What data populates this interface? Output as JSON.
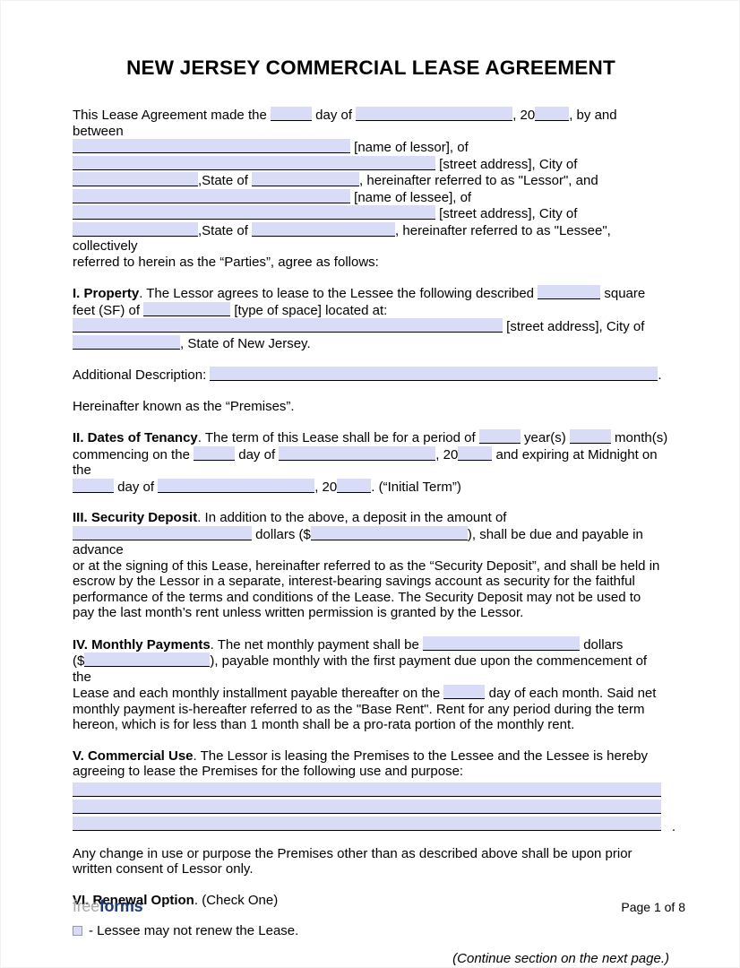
{
  "document": {
    "title": "NEW JERSEY COMMERCIAL LEASE AGREEMENT"
  },
  "intro": {
    "line1_a": "This Lease Agreement made the",
    "line1_b": "day of",
    "line1_c": ", 20",
    "line1_d": ", by and between",
    "line2": "[name of lessor], of",
    "line3": "[street address], City of",
    "line4_a": ",State of",
    "line4_b": ", hereinafter referred to as \"Lessor\", and",
    "line5": "[name of lessee], of",
    "line6": "[street address], City of",
    "line7_a": ",State of",
    "line7_b": ", hereinafter referred to as \"Lessee\", collectively",
    "line8": "referred to herein as the “Parties”, agree as follows:"
  },
  "sections": {
    "property": {
      "heading": "I. Property",
      "line1_a": ". The Lessor agrees to lease to the Lessee the following described",
      "line1_b": "square",
      "line2_a": "feet (SF) of",
      "line2_b": "[type of space] located at:",
      "line3": "[street address], City of",
      "line4": ", State of New Jersey.",
      "additional_label": "Additional Description:",
      "additional_period": ".",
      "hereinafter": "Hereinafter known as the “Premises”."
    },
    "dates": {
      "heading": "II. Dates of Tenancy",
      "line1_a": ". The term of this Lease shall be for a period of",
      "line1_b": "year(s)",
      "line1_c": "month(s)",
      "line2_a": "commencing on the",
      "line2_b": "day of",
      "line2_c": ", 20",
      "line2_d": "and expiring at Midnight on the",
      "line3_a": "day of",
      "line3_b": ", 20",
      "line3_c": ". (“Initial Term”)"
    },
    "security": {
      "heading": "III. Security Deposit",
      "line1": ". In addition to the above, a deposit in the amount of",
      "line2_a": "dollars ($",
      "line2_b": "), shall be due and payable in advance",
      "line3": "or at the signing of this Lease, hereinafter referred to as the “Security Deposit”, and shall be held in",
      "line4": "escrow by the Lessor in a separate, interest-bearing savings account as security for the faithful",
      "line5": "performance of the terms and conditions of the Lease. The Security Deposit may not be used to",
      "line6": "pay the last month’s rent unless written permission is granted by the Lessor."
    },
    "monthly": {
      "heading": "IV. Monthly Payments",
      "line1_a": ". The net monthly payment shall be",
      "line1_b": "dollars",
      "line2_a": "($",
      "line2_b": "), payable monthly with the first payment due upon the commencement of the",
      "line3_a": "Lease and each monthly installment payable thereafter on the",
      "line3_b": "day of each month. Said net",
      "line4": "monthly payment is-hereafter referred to as the \"Base Rent\". Rent for any period during the term",
      "line5": "hereon, which is for less than 1 month shall be a pro-rata portion of the monthly rent."
    },
    "commercial": {
      "heading": "V. Commercial Use",
      "line1": ". The Lessor is leasing the Premises to the Lessee and the Lessee is hereby",
      "line2": "agreeing to lease the Premises for the following use and purpose:",
      "blank_lines": 3,
      "trailing_period": ".",
      "after_line1": "Any change in use or purpose the Premises other than as described above shall be upon prior",
      "after_line2": "written consent of Lessor only."
    },
    "renewal": {
      "heading": "VI. Renewal Option",
      "heading_suffix": ". (Check One)",
      "option1": "- Lessee may not renew the Lease."
    }
  },
  "continue_note": "(Continue section on the next page.)",
  "footer": {
    "logo_part1": "free",
    "logo_part2": "forms",
    "page_number": "Page 1 of 8"
  },
  "colors": {
    "field_fill": "#d9dcf7",
    "logo_gray": "#a8a8a8",
    "logo_blue": "#1f3a76"
  }
}
